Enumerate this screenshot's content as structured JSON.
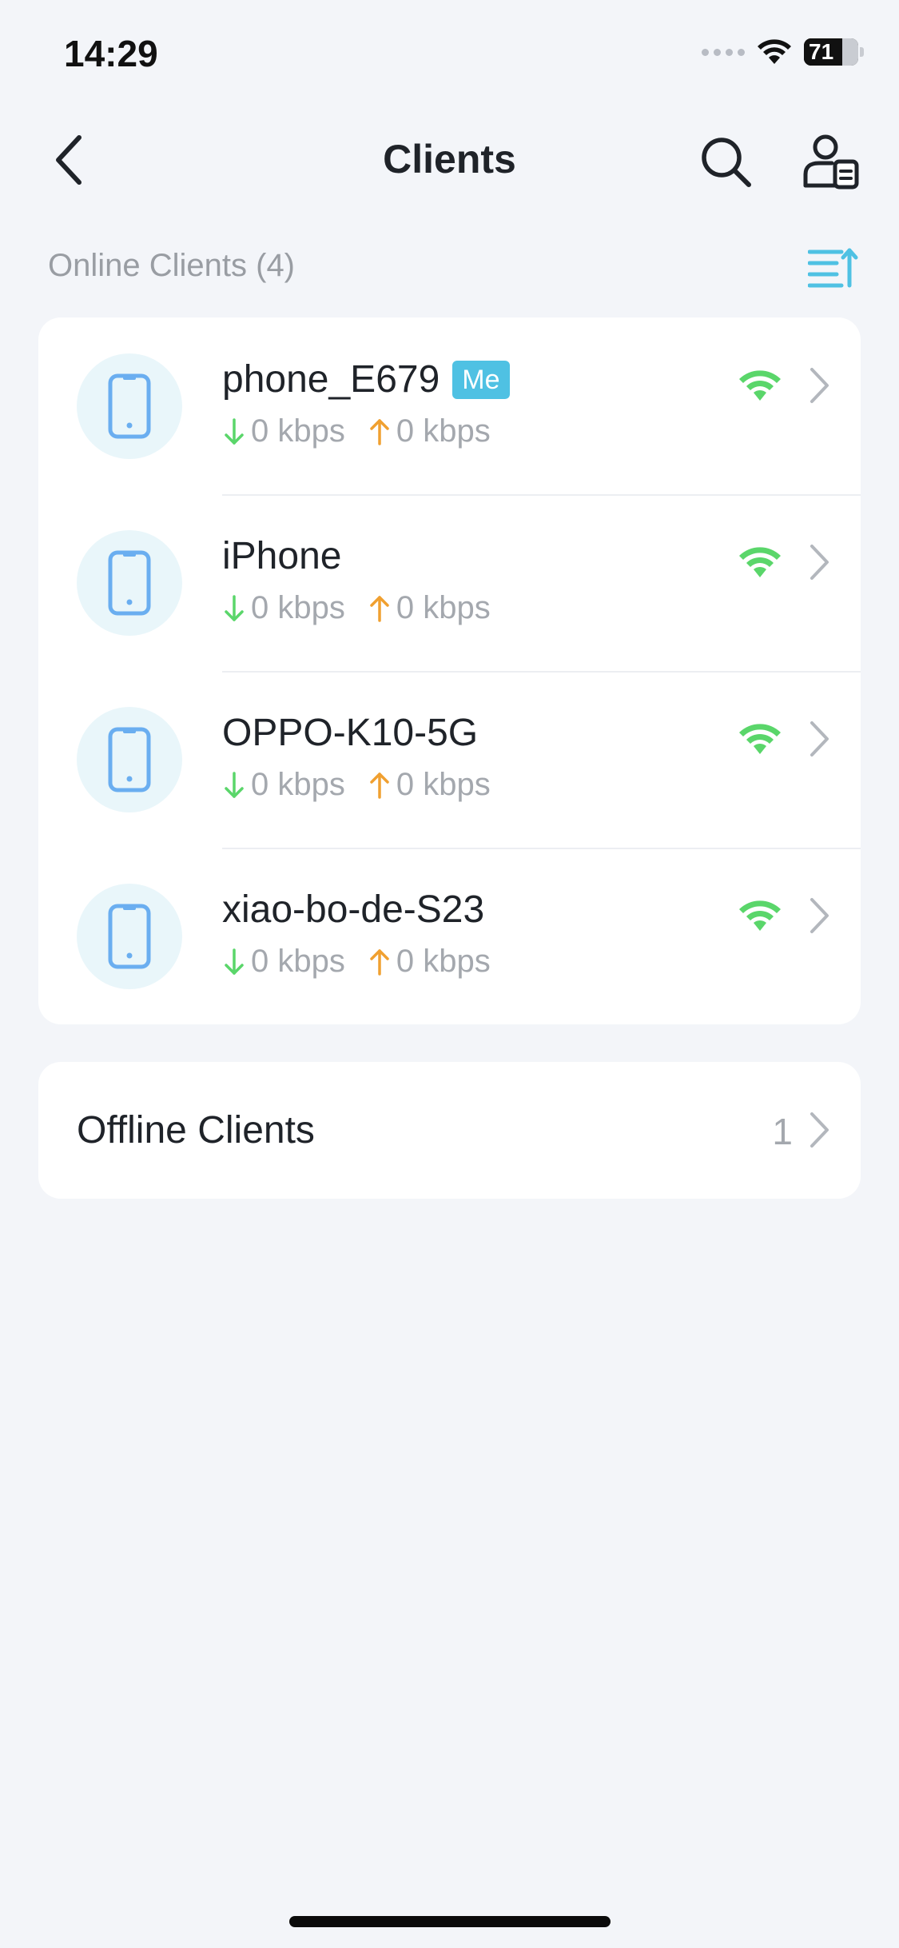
{
  "status_bar": {
    "time": "14:29",
    "battery": "71",
    "battery_level": 0.71
  },
  "nav": {
    "title": "Clients"
  },
  "online": {
    "header": "Online Clients (4)",
    "clients": [
      {
        "name": "phone_E679",
        "badge": "Me",
        "download": "0 kbps",
        "upload": "0 kbps"
      },
      {
        "name": "iPhone",
        "download": "0 kbps",
        "upload": "0 kbps"
      },
      {
        "name": "OPPO-K10-5G",
        "download": "0 kbps",
        "upload": "0 kbps"
      },
      {
        "name": "xiao-bo-de-S23",
        "download": "0 kbps",
        "upload": "0 kbps"
      }
    ]
  },
  "offline": {
    "label": "Offline Clients",
    "count": "1"
  },
  "icons": {
    "back": "chevron-left-icon",
    "search": "search-icon",
    "client_manage": "user-card-icon",
    "sort": "sort-icon",
    "device": "phone-icon",
    "signal": "wifi-icon",
    "download": "arrow-down-icon",
    "upload": "arrow-up-icon",
    "row_chevron": "chevron-right-icon"
  },
  "colors": {
    "accent": "#4fc1e3",
    "wifi": "#5ad66a",
    "download_arrow": "#5ad66a",
    "upload_arrow": "#f0a030",
    "device_icon": "#6aaef0",
    "avatar_bg": "#e9f6fa",
    "background": "#f3f5f9"
  }
}
